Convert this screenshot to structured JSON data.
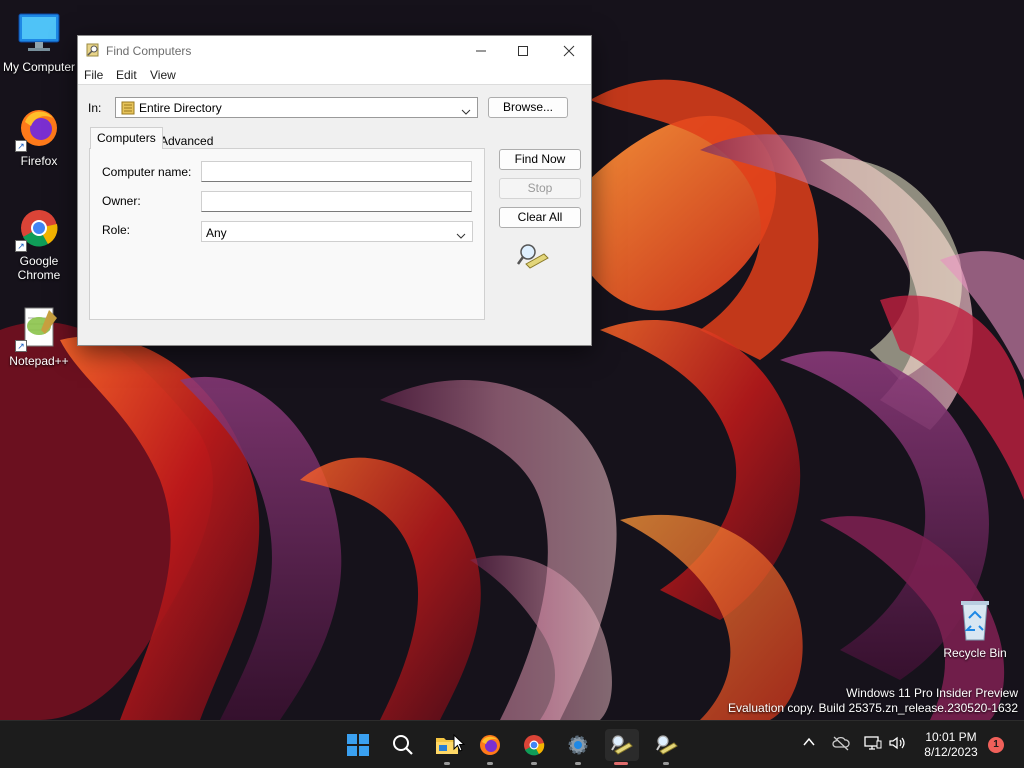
{
  "desktop": {
    "icons": [
      {
        "label": "My Computer"
      },
      {
        "label": "Firefox"
      },
      {
        "label": "Google Chrome"
      },
      {
        "label": "Notepad++"
      },
      {
        "label": "Recycle Bin"
      }
    ],
    "watermark": {
      "line1": "Windows 11 Pro Insider Preview",
      "line2": "Evaluation copy. Build 25375.zn_release.230520-1632"
    }
  },
  "window": {
    "title": "Find Computers",
    "menu": [
      "File",
      "Edit",
      "View"
    ],
    "in_label": "In:",
    "in_value": "Entire Directory",
    "browse_label": "Browse...",
    "tabs": [
      "Computers",
      "Advanced"
    ],
    "fields": {
      "computer_name_label": "Computer name:",
      "computer_name_value": "",
      "owner_label": "Owner:",
      "owner_value": "",
      "role_label": "Role:",
      "role_value": "Any"
    },
    "buttons": {
      "find_now": "Find Now",
      "stop": "Stop",
      "clear_all": "Clear All"
    }
  },
  "taskbar": {
    "apps": [
      "start",
      "search",
      "file-explorer",
      "firefox",
      "chrome",
      "settings",
      "find-computers",
      "find-computers-2"
    ],
    "clock_time": "10:01 PM",
    "clock_date": "8/12/2023",
    "notification_count": "1"
  },
  "colors": {
    "taskbar": "#1c1c1c",
    "wallpaper_dark": "#15121c",
    "accent_red": "#d8331f",
    "dialog_bg": "#f0f0f0"
  }
}
